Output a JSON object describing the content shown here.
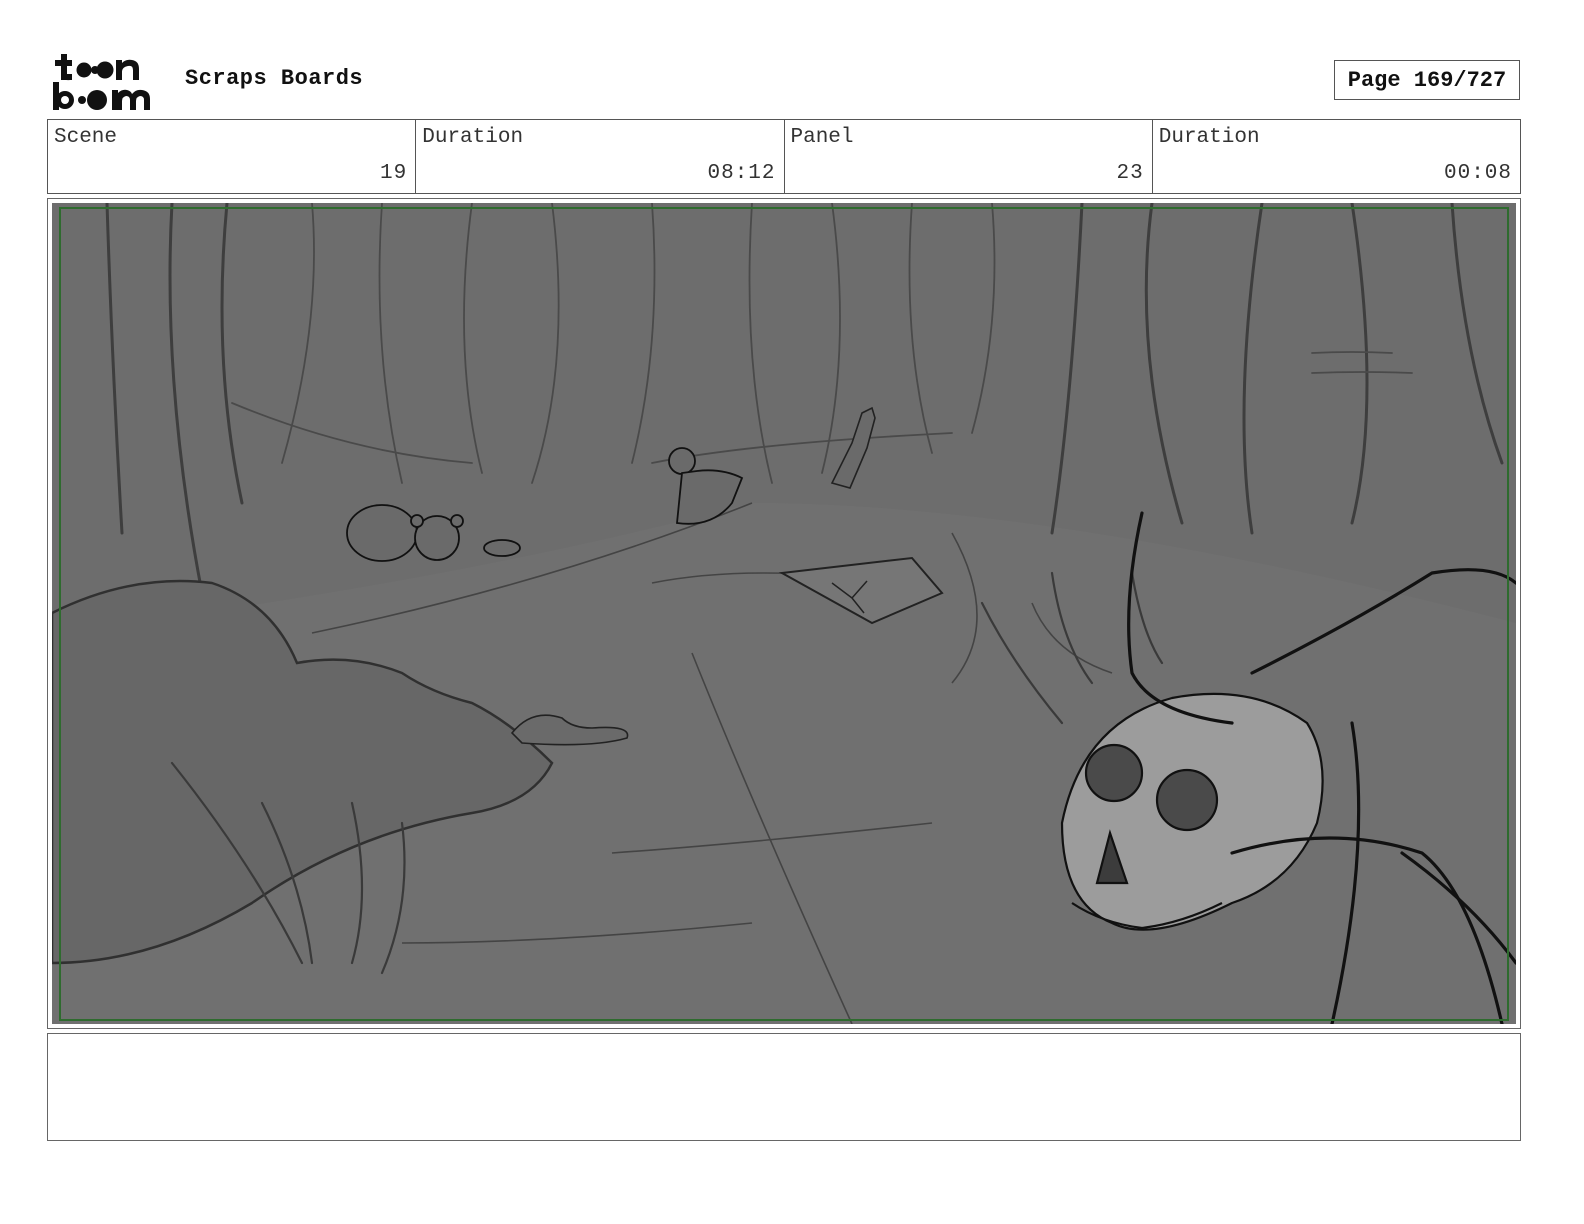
{
  "header": {
    "logo_text": "toon boom",
    "title": "Scraps Boards",
    "page_label": "Page 169/727"
  },
  "info": {
    "scene_label": "Scene",
    "scene_value": "19",
    "scene_duration_label": "Duration",
    "scene_duration_value": "08:12",
    "panel_label": "Panel",
    "panel_value": "23",
    "panel_duration_label": "Duration",
    "panel_duration_value": "00:08"
  },
  "panel": {
    "safe_frame_color": "#2e6b2e",
    "background_color": "#6d6d6d",
    "description": ""
  },
  "notes": {
    "text": ""
  }
}
